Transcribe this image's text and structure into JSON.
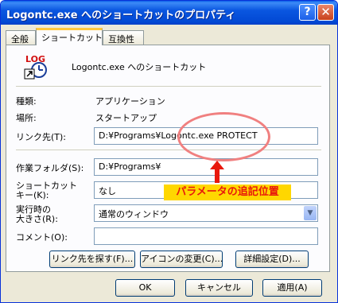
{
  "window": {
    "title": "Logontc.exe へのショートカットのプロパティ",
    "help_glyph": "?",
    "close_glyph": "✕"
  },
  "tabs": [
    {
      "label": "全般",
      "active": false
    },
    {
      "label": "ショートカット",
      "active": true
    },
    {
      "label": "互換性",
      "active": false
    }
  ],
  "header": {
    "icon_text": "LOG",
    "name": "Logontc.exe へのショートカット"
  },
  "info": {
    "type_label": "種類:",
    "type_value": "アプリケーション",
    "location_label": "場所:",
    "location_value": "スタートアップ"
  },
  "fields": {
    "target_label": "リンク先(T):",
    "target_value": "D:¥Programs¥Logontc.exe PROTECT",
    "workdir_label": "作業フォルダ(S):",
    "workdir_value": "D:¥Programs¥",
    "hotkey_label_1": "ショートカット",
    "hotkey_label_2": "キー(K):",
    "hotkey_value": "なし",
    "run_label_1": "実行時の",
    "run_label_2": "大きさ(R):",
    "run_value": "通常のウィンドウ",
    "comment_label": "コメント(O):",
    "comment_value": ""
  },
  "panel_buttons": {
    "find_target": "リンク先を探す(F)...",
    "change_icon": "アイコンの変更(C)...",
    "advanced": "詳細設定(D)..."
  },
  "footer_buttons": {
    "ok": "OK",
    "cancel": "キャンセル",
    "apply": "適用(A)"
  },
  "annotation": {
    "label": "パラメータの追記位置",
    "ring_color": "#f08080",
    "label_color": "#e8180c",
    "label_bg": "#ffd700"
  },
  "colors": {
    "titlebar": "#0a56e0",
    "dialog_bg": "#ece9d8",
    "field_border": "#7f9db9"
  }
}
